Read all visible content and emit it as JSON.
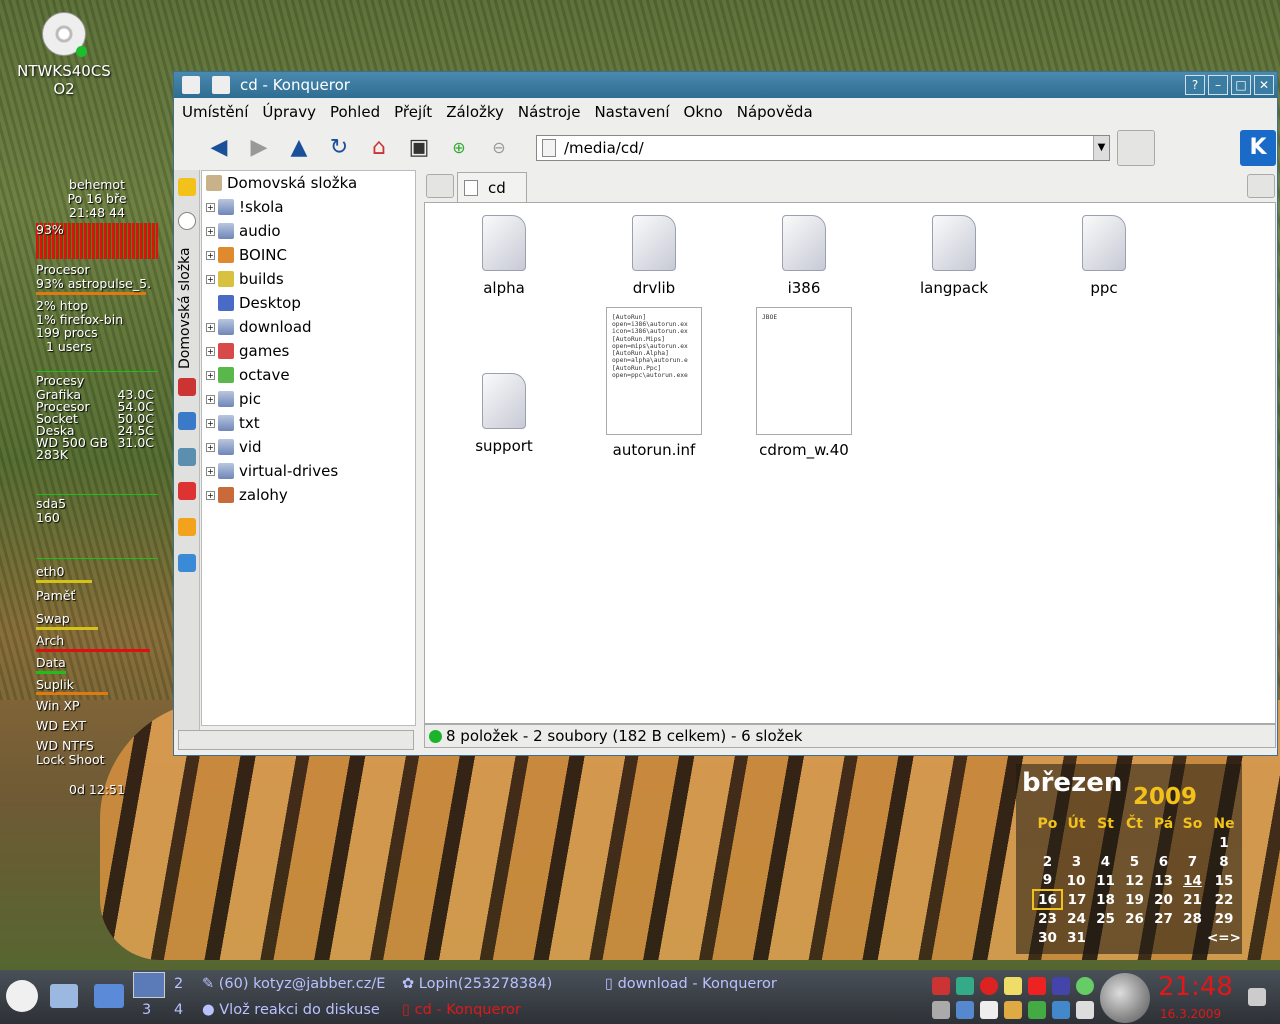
{
  "desktop": {
    "icon_label_1": "NTWKS40CS",
    "icon_label_2": "O2"
  },
  "sysmon": {
    "host": "behemot",
    "date": "Po 16 bře",
    "time": "21:48 44",
    "cpu_pct": "93%",
    "cpu_label": "Procesor",
    "p1": "93% astropulse_5.",
    "p2": "2% htop",
    "p3": "1% firefox-bin",
    "procs": "199 procs",
    "users": "1 users",
    "procesy": "Procesy",
    "temps": [
      {
        "n": "Grafika",
        "v": "43.0C"
      },
      {
        "n": "Procesor",
        "v": "54.0C"
      },
      {
        "n": "Socket",
        "v": "50.0C"
      },
      {
        "n": "Deska",
        "v": "24.5C"
      },
      {
        "n": "WD 500 GB",
        "v": "31.0C"
      }
    ],
    "net1": "283K",
    "disk": "sda5",
    "disk_val": "160",
    "eth": "eth0",
    "mem": "Paměť",
    "swap": "Swap",
    "parts": [
      "Arch",
      "Data",
      "Suplik",
      "Win XP",
      "WD EXT",
      "WD NTFS"
    ],
    "lock": "Lock",
    "shoot": "Shoot",
    "uptime": "0d 12:51"
  },
  "window": {
    "title": "cd - Konqueror",
    "menu": [
      "Umístění",
      "Úpravy",
      "Pohled",
      "Přejít",
      "Záložky",
      "Nástroje",
      "Nastavení",
      "Okno",
      "Nápověda"
    ],
    "url": "/media/cd/",
    "sidebar_label": "Domovská složka",
    "tree_root": "Domovská složka",
    "tree": [
      "!skola",
      "audio",
      "BOINC",
      "builds",
      "Desktop",
      "download",
      "games",
      "octave",
      "pic",
      "txt",
      "vid",
      "virtual-drives",
      "zalohy"
    ],
    "tab": "cd",
    "files": [
      "alpha",
      "drvlib",
      "i386",
      "langpack",
      "ppc",
      "support"
    ],
    "doc_files": [
      "autorun.inf",
      "cdrom_w.40"
    ],
    "autorun_text": "[AutoRun]\nopen=i386\\autorun.ex\nicon=i386\\autorun.ex\n[AutoRun.Mips]\nopen=mips\\autorun.ex\n[AutoRun.Alpha]\nopen=alpha\\autorun.e\n[AutoRun.Ppc]\nopen=ppc\\autorun.exe",
    "cdrom_text": "JBOE",
    "status": "8 položek - 2 soubory (182 B celkem) - 6 složek"
  },
  "calendar": {
    "month": "březen",
    "year": "2009",
    "days": [
      "Po",
      "Út",
      "St",
      "Čt",
      "Pá",
      "So",
      "Ne"
    ],
    "weeks": [
      [
        "",
        "",
        "",
        "",
        "",
        "",
        "1"
      ],
      [
        "2",
        "3",
        "4",
        "5",
        "6",
        "7",
        "8"
      ],
      [
        "9",
        "10",
        "11",
        "12",
        "13",
        "14",
        "15"
      ],
      [
        "16",
        "17",
        "18",
        "19",
        "20",
        "21",
        "22"
      ],
      [
        "23",
        "24",
        "25",
        "26",
        "27",
        "28",
        "29"
      ],
      [
        "30",
        "31",
        "",
        "",
        "",
        "",
        ""
      ]
    ],
    "today": "16",
    "nav": "<=>"
  },
  "taskbar": {
    "desk2": "2",
    "desk3": "3",
    "desk4": "4",
    "t1": "(60) kotyz@jabber.cz/E",
    "t2": "Lopin(253278384)",
    "t3": "download - Konqueror",
    "t4": "Vlož reakci do diskuse",
    "t5": "cd - Konqueror",
    "clock": "21:48",
    "date": "16.3.2009"
  },
  "colors": {
    "title": "#2f6d92",
    "accent": "#f2c21b",
    "clock": "#e01818"
  }
}
